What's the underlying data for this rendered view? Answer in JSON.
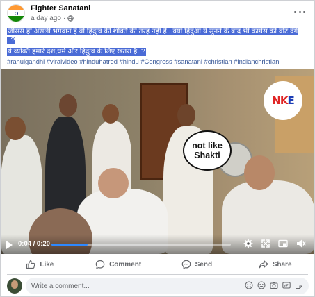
{
  "post": {
    "author": "Fighter Sanatani",
    "time": "a day ago",
    "separator": "·",
    "privacy_icon": "globe-icon",
    "caption_line1": "जीसस ही असली भगवान है वो हिंदुत्व की शक्ति की तरह नहीं है ..क्यों हिंदुओ ये सुनने के बाद भी कांग्रेस को वोट देंगे ..?",
    "caption_line2": "ये व्यक्ति हमारे देश,धर्म और हिंदुत्व के लिए खतरा है..?",
    "hashtags": "#rahulgandhi #viralvideo #hinduhatred #hindu #Congress #sanatani #christian #indianchristian",
    "colors": {
      "highlight": "#4a6bd6",
      "hashtag": "#385898",
      "accent": "#2d88ff"
    }
  },
  "video": {
    "bubble_line1": "not like",
    "bubble_line2": "Shakti",
    "logo_text_red": "NK",
    "logo_text_blue": "E",
    "time_display": "0:04 / 0:20",
    "progress": 0.2,
    "controls": [
      "play-icon",
      "settings-icon",
      "fullscreen-icon",
      "picture-in-picture-icon",
      "volume-icon"
    ]
  },
  "actions": {
    "like": "Like",
    "comment": "Comment",
    "send": "Send",
    "share": "Share"
  },
  "comment_box": {
    "placeholder": "Write a comment...",
    "icons": [
      "sticker-icon",
      "emoji-icon",
      "camera-icon",
      "gif-icon",
      "stickers-icon"
    ]
  }
}
